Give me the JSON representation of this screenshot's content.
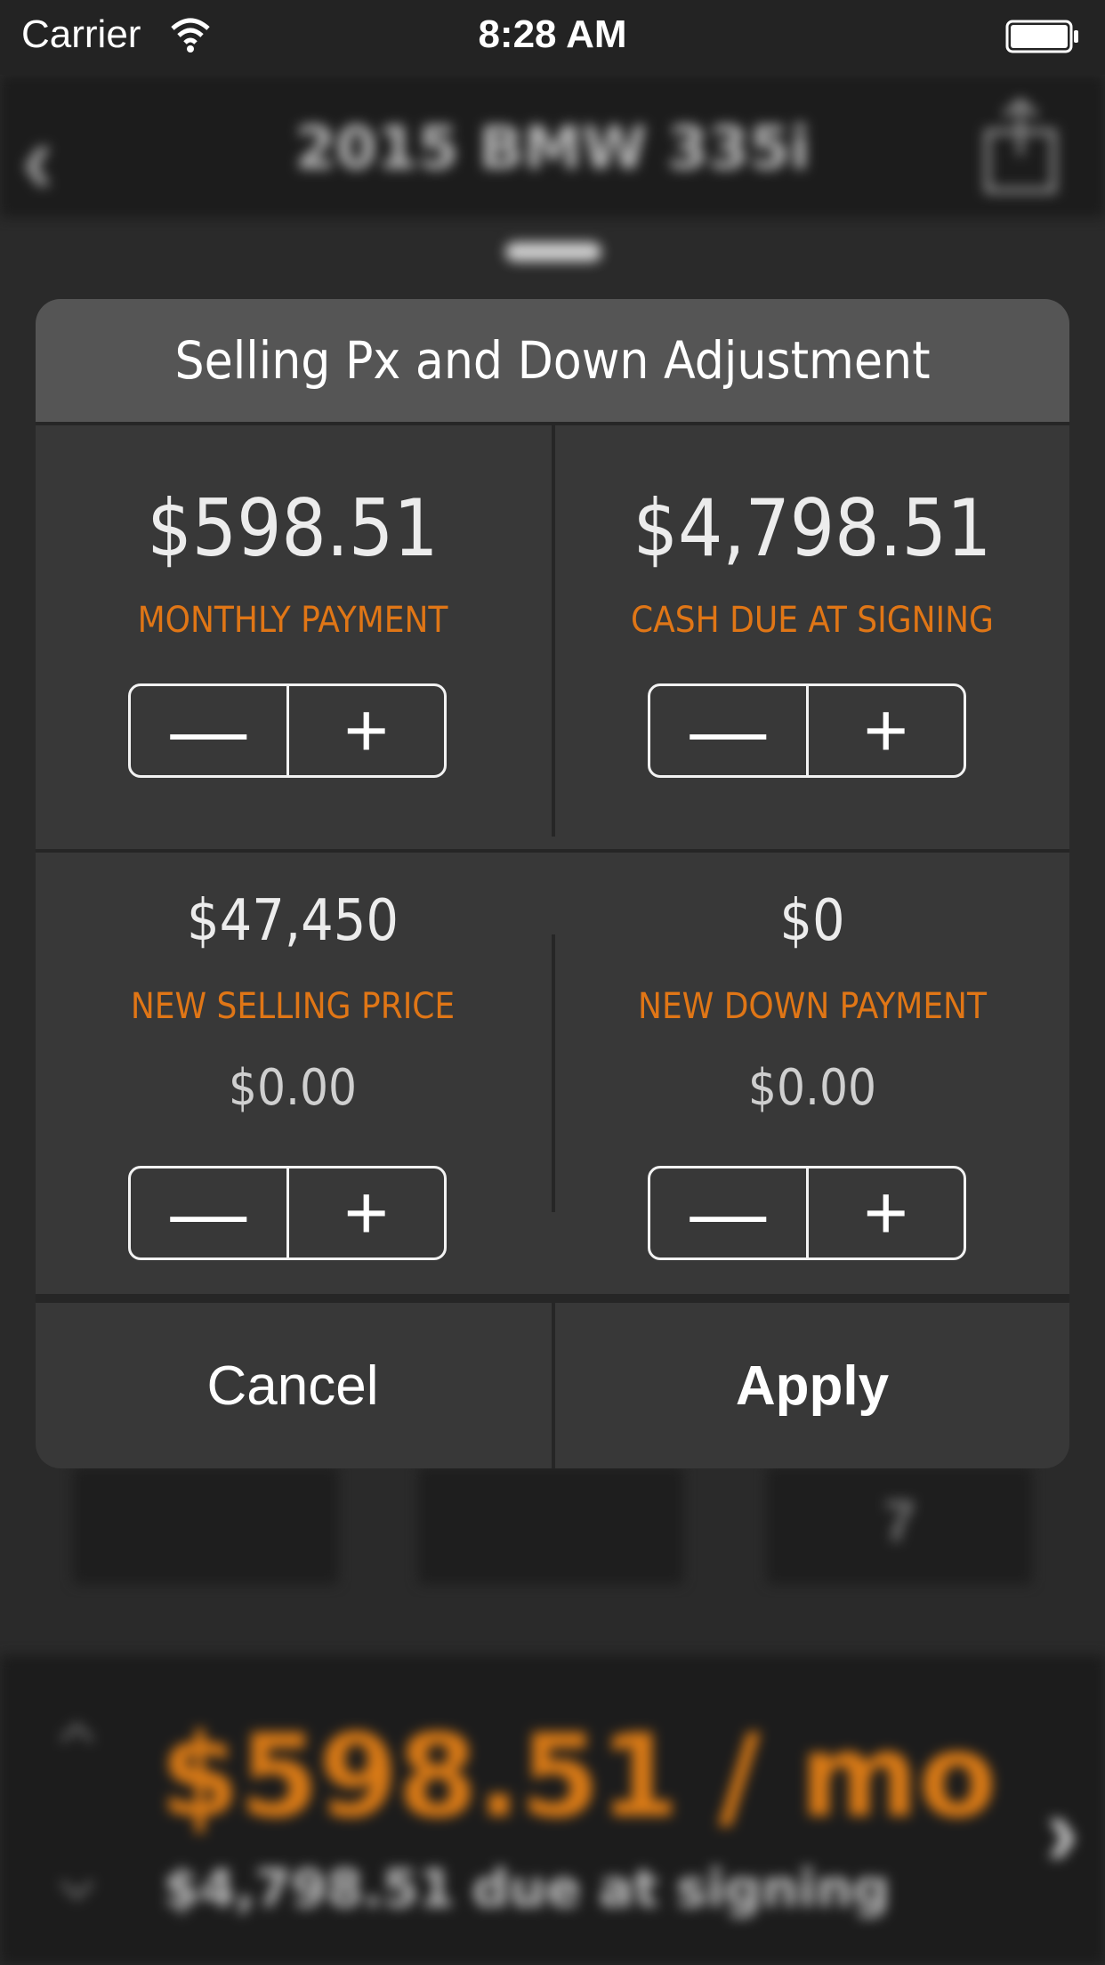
{
  "status_bar": {
    "carrier": "Carrier",
    "time": "8:28 AM",
    "wifi_icon": "wifi-icon",
    "battery_icon": "battery-icon"
  },
  "nav": {
    "title": "2015 BMW 335i",
    "back_icon": "chevron-left-icon",
    "share_icon": "share-icon"
  },
  "modal": {
    "title": "Selling Px and Down Adjustment",
    "monthly": {
      "value": "$598.51",
      "label": "MONTHLY PAYMENT"
    },
    "cash_due": {
      "value": "$4,798.51",
      "label": "CASH DUE AT SIGNING"
    },
    "selling_price": {
      "value": "$47,450",
      "label": "NEW SELLING PRICE",
      "adjustment": "$0.00"
    },
    "down_payment": {
      "value": "$0",
      "label": "NEW DOWN PAYMENT",
      "adjustment": "$0.00"
    },
    "stepper": {
      "minus": "—",
      "plus": "+"
    },
    "cancel_label": "Cancel",
    "apply_label": "Apply"
  },
  "background": {
    "tile_text": "7",
    "bottom_payment": "$598.51 / mo",
    "bottom_due": "$4,798.51 due at signing",
    "arrow_up_icon": "chevron-up-icon",
    "arrow_down_icon": "chevron-down-icon",
    "next_icon": "chevron-right-icon"
  },
  "colors": {
    "accent_orange": "#e07616",
    "modal_bg": "#383838",
    "header_bg": "#555555"
  }
}
